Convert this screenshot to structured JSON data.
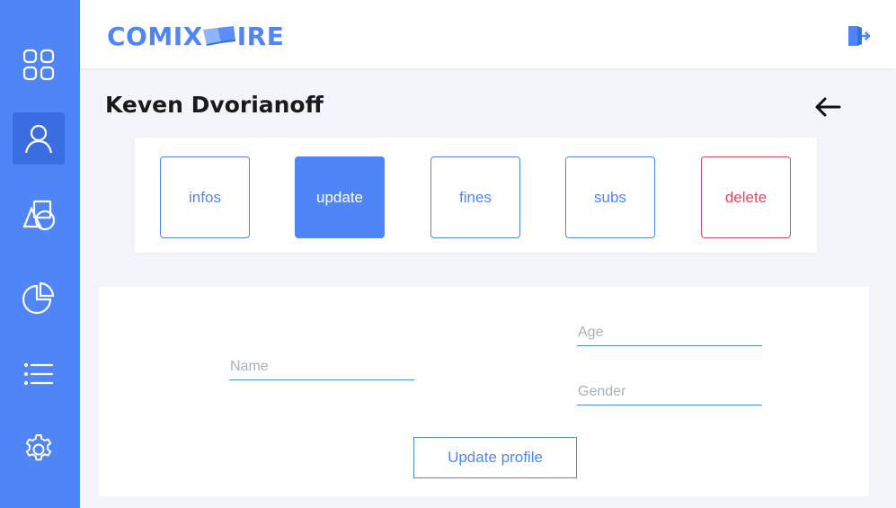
{
  "app": {
    "logo_left": "COMIX",
    "logo_right": "IRE"
  },
  "sidebar": {
    "items": [
      {
        "icon": "dashboard-icon",
        "active": false
      },
      {
        "icon": "user-icon",
        "active": true
      },
      {
        "icon": "shapes-icon",
        "active": false
      },
      {
        "icon": "pie-chart-icon",
        "active": false
      },
      {
        "icon": "list-icon",
        "active": false
      },
      {
        "icon": "gear-icon",
        "active": false
      }
    ]
  },
  "header": {
    "logout_icon": "logout-icon"
  },
  "page": {
    "title": "Keven Dvorianoff",
    "back_icon": "arrow-left-icon"
  },
  "actions": {
    "infos": "infos",
    "update": "update",
    "fines": "fines",
    "subs": "subs",
    "delete": "delete",
    "active": "update"
  },
  "form": {
    "name_placeholder": "Name",
    "age_placeholder": "Age",
    "gender_placeholder": "Gender",
    "name_value": "",
    "age_value": "",
    "gender_value": "",
    "submit_label": "Update profile"
  },
  "colors": {
    "accent": "#4f85f6",
    "danger": "#e0485c",
    "background": "#f4f5fb"
  }
}
